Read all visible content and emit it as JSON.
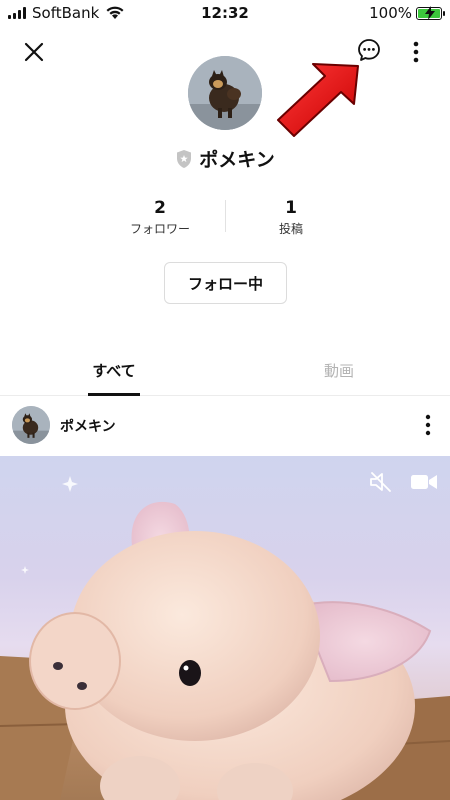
{
  "status_bar": {
    "carrier": "SoftBank",
    "time": "12:32",
    "battery_percent": "100%",
    "battery_level": 1.0,
    "battery_color": "#3cc83c",
    "signal_bars": 4
  },
  "header": {
    "close_icon": "close-icon",
    "chat_icon": "chat-bubble-icon",
    "more_icon": "more-vertical-icon"
  },
  "annotation": {
    "arrow_color": "#e00000",
    "arrow_icon": "red-arrow-pointing-at-chat"
  },
  "profile": {
    "name": "ポメキン",
    "badge_icon": "shield-icon",
    "stats": {
      "followers_count": "2",
      "followers_label": "フォロワー",
      "posts_count": "1",
      "posts_label": "投稿"
    },
    "follow_button_label": "フォロー中"
  },
  "tabs": [
    {
      "label": "すべて",
      "active": true
    },
    {
      "label": "動画",
      "active": false
    }
  ],
  "post": {
    "author": "ポメキン",
    "more_icon": "more-vertical-icon",
    "media_controls": {
      "mute_icon": "speaker-muted-icon",
      "video_icon": "video-camera-icon"
    }
  }
}
